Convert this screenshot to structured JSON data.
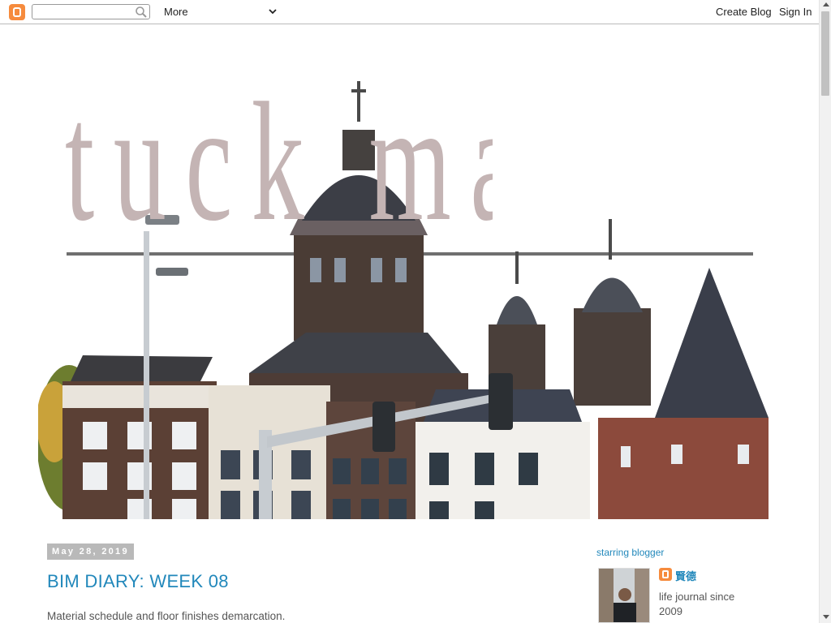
{
  "navbar": {
    "logo_icon": "blogger-logo-icon",
    "search_icon": "search-icon",
    "more_label": "More",
    "more_icon": "chevron-down-icon",
    "create_blog_label": "Create Blog",
    "sign_in_label": "Sign In"
  },
  "header": {
    "title": "tuck made"
  },
  "post": {
    "date": "May 28, 2019",
    "title": "BIM DIARY: WEEK 08",
    "excerpt": "Material schedule and floor finishes demarcation."
  },
  "sidebar": {
    "widget_title": "starring blogger",
    "profile_name": "賢德",
    "profile_about": "life journal since 2009",
    "profile_icon": "blogger-logo-icon"
  },
  "colors": {
    "link": "#2288bb",
    "blogger_orange": "#f68b3d",
    "title_mauve": "#c4b4b4",
    "date_bg": "#b9b9b9"
  }
}
